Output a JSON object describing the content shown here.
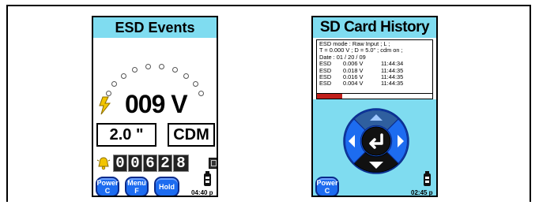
{
  "esd_screen": {
    "title": "ESD Events",
    "voltage": "009 V",
    "distance": "2.0 \"",
    "mode": "CDM",
    "counter_digits": [
      "0",
      "0",
      "6",
      "2",
      "8"
    ],
    "buttons": {
      "power": {
        "line1": "Power",
        "line2": "C"
      },
      "menu": {
        "line1": "Menu",
        "line2": "F"
      },
      "hold": {
        "line1": "Hold"
      }
    },
    "time": "04:40 p",
    "colors": {
      "title_bg": "#7fdcf0",
      "button": "#1d6cf0",
      "bolt": "#f2c500"
    }
  },
  "sd_screen": {
    "title": "SD Card History",
    "header_lines": [
      "ESD mode : Raw Input ; L ;",
      "T = 0.000 V ; D = 5.0\" ; cdm on ;",
      "Date : 01 / 20 / 09"
    ],
    "rows": [
      {
        "type": "ESD",
        "value": "0.006 V",
        "time": "11:44:34"
      },
      {
        "type": "ESD",
        "value": "0.018 V",
        "time": "11:44:35"
      },
      {
        "type": "ESD",
        "value": "0.016 V",
        "time": "11:44:35"
      },
      {
        "type": "ESD",
        "value": "0.004 V",
        "time": "11:44:35"
      }
    ],
    "progress_fraction": 0.22,
    "buttons": {
      "power": {
        "line1": "Power",
        "line2": "C"
      }
    },
    "time": "02:45 p",
    "colors": {
      "dpad_ring": "#1d6cf0",
      "dpad_dark": "#111111",
      "progress": "#c0201c"
    }
  }
}
